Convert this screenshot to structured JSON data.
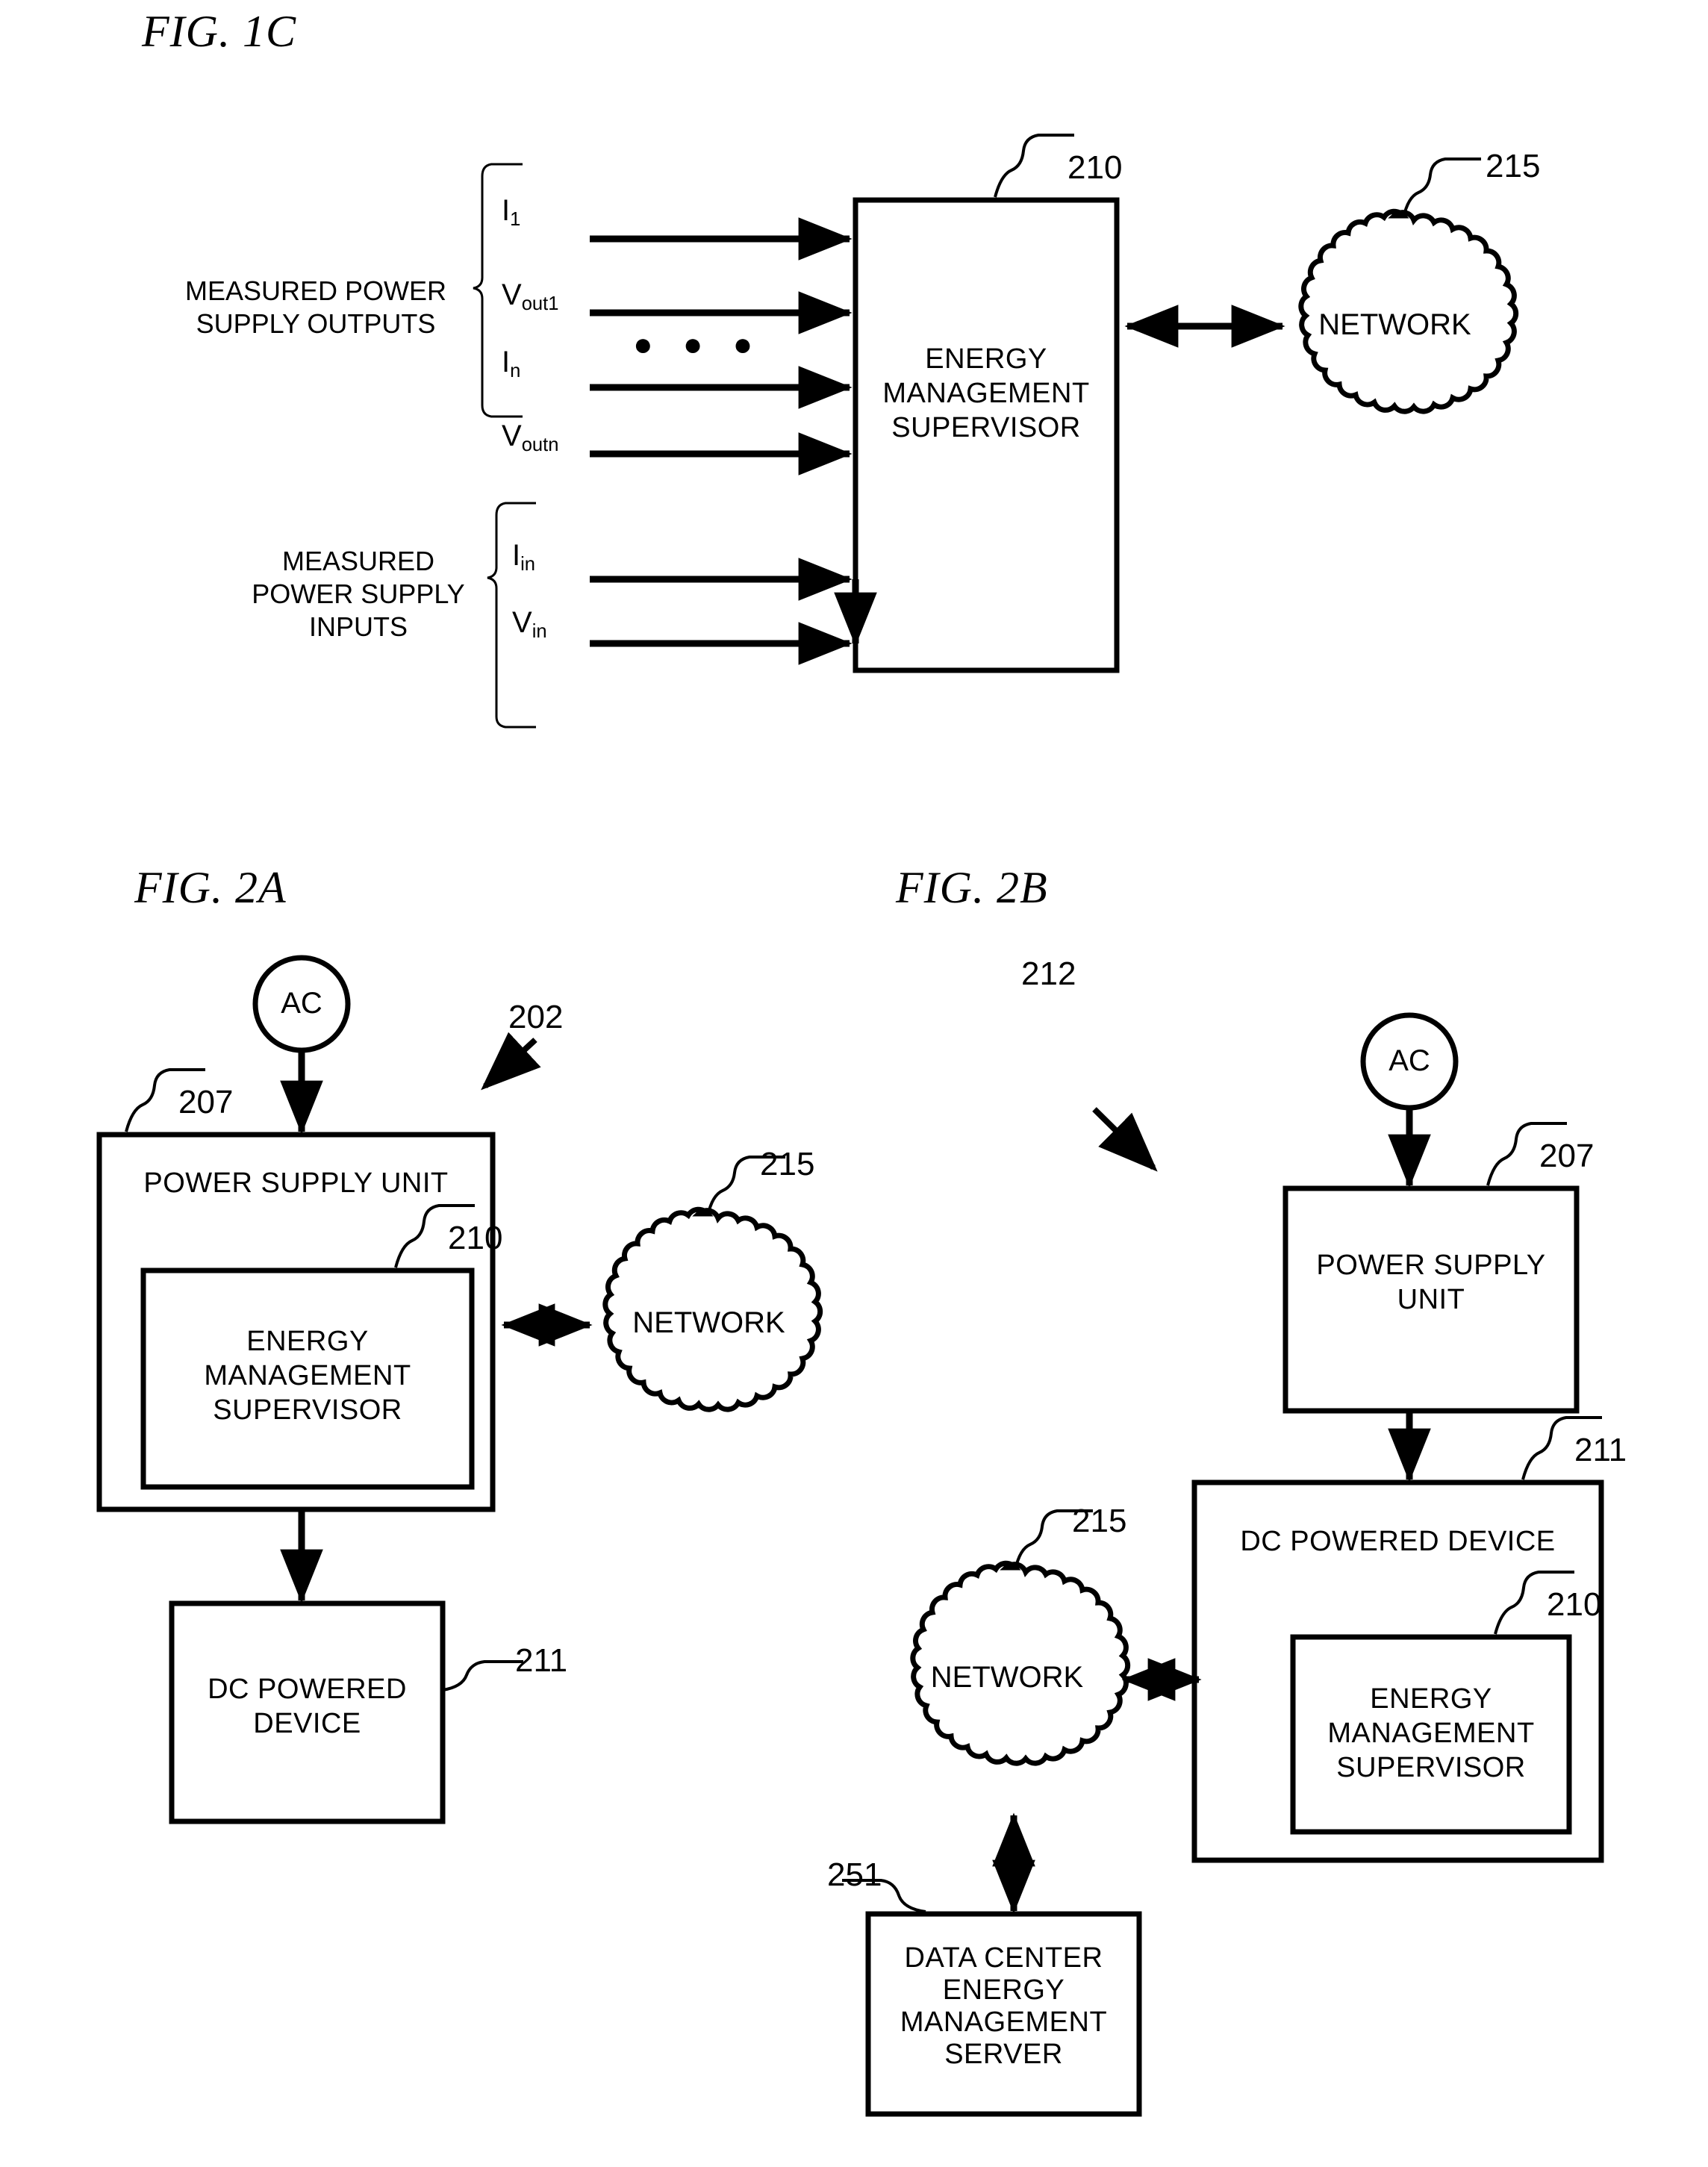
{
  "page": {
    "background": "#ffffff",
    "ink": "#000000"
  },
  "figures": [
    {
      "id": "fig-1c",
      "title": "FIG. 1C",
      "brace_groups": [
        {
          "id": "measured-power-supply-outputs",
          "label": "MEASURED POWER\nSUPPLY OUTPUTS"
        },
        {
          "id": "measured-power-supply-inputs",
          "label": "MEASURED\nPOWER SUPPLY\nINPUTS"
        }
      ],
      "signals": [
        {
          "id": "signal-i1",
          "base": "I",
          "sub": "1"
        },
        {
          "id": "signal-vout1",
          "base": "V",
          "sub": "out1"
        },
        {
          "id": "signal-in",
          "base": "I",
          "sub": "n"
        },
        {
          "id": "signal-voutn",
          "base": "V",
          "sub": "outn"
        },
        {
          "id": "signal-iin",
          "base": "I",
          "sub": "in"
        },
        {
          "id": "signal-vin",
          "base": "V",
          "sub": "in"
        }
      ],
      "ellipsis": "● ● ●",
      "blocks": [
        {
          "id": "energy-management-supervisor",
          "label": "ENERGY\nMANAGEMENT\nSUPERVISOR",
          "ref": "210"
        },
        {
          "id": "network-cloud",
          "label": "NETWORK",
          "ref": "215"
        }
      ]
    },
    {
      "id": "fig-2a",
      "title": "FIG. 2A",
      "system_ref": "202",
      "blocks": [
        {
          "id": "ac-source",
          "label": "AC"
        },
        {
          "id": "power-supply-unit",
          "label": "POWER SUPPLY UNIT",
          "ref": "207"
        },
        {
          "id": "energy-management-supervisor",
          "label": "ENERGY\nMANAGEMENT\nSUPERVISOR",
          "ref": "210"
        },
        {
          "id": "network-cloud",
          "label": "NETWORK",
          "ref": "215"
        },
        {
          "id": "dc-powered-device",
          "label": "DC POWERED\nDEVICE",
          "ref": "211"
        }
      ]
    },
    {
      "id": "fig-2b",
      "title": "FIG. 2B",
      "system_ref": "212",
      "blocks": [
        {
          "id": "ac-source",
          "label": "AC"
        },
        {
          "id": "power-supply-unit",
          "label": "POWER SUPPLY\nUNIT",
          "ref": "207"
        },
        {
          "id": "dc-powered-device",
          "label": "DC POWERED DEVICE",
          "ref": "211"
        },
        {
          "id": "energy-management-supervisor",
          "label": "ENERGY\nMANAGEMENT\nSUPERVISOR",
          "ref": "210"
        },
        {
          "id": "network-cloud",
          "label": "NETWORK",
          "ref": "215"
        },
        {
          "id": "data-center-energy-management-server",
          "label": "DATA CENTER\nENERGY\nMANAGEMENT\nSERVER",
          "ref": "251"
        }
      ]
    }
  ]
}
